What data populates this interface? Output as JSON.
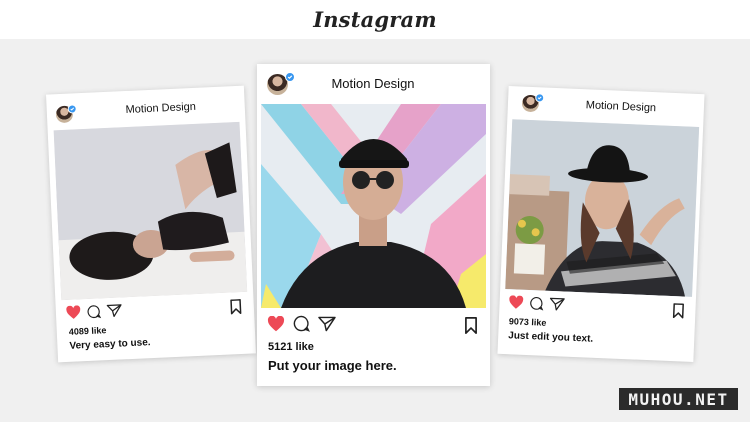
{
  "brand": {
    "logo_text": "Instagram"
  },
  "posts": [
    {
      "username": "Motion Design",
      "verified": true,
      "photo_subject": "woman-lying-on-bed",
      "likes": "4089 like",
      "caption": "Very easy to use.",
      "liked": true
    },
    {
      "username": "Motion Design",
      "verified": true,
      "photo_subject": "man-in-cap-and-sunglasses",
      "likes": "5121 like",
      "caption": "Put your image here.",
      "liked": true
    },
    {
      "username": "Motion Design",
      "verified": true,
      "photo_subject": "woman-in-black-hat",
      "likes": "9073 like",
      "caption": "Just edit you text.",
      "liked": true
    }
  ],
  "icons": [
    "heart-icon",
    "comment-icon",
    "share-icon",
    "bookmark-icon",
    "verified-badge-icon"
  ],
  "colors": {
    "like_red": "#ed4956",
    "verified_blue": "#3897f0",
    "background": "#f0f0f0"
  },
  "watermark": {
    "text": "MUHOU.NET"
  }
}
